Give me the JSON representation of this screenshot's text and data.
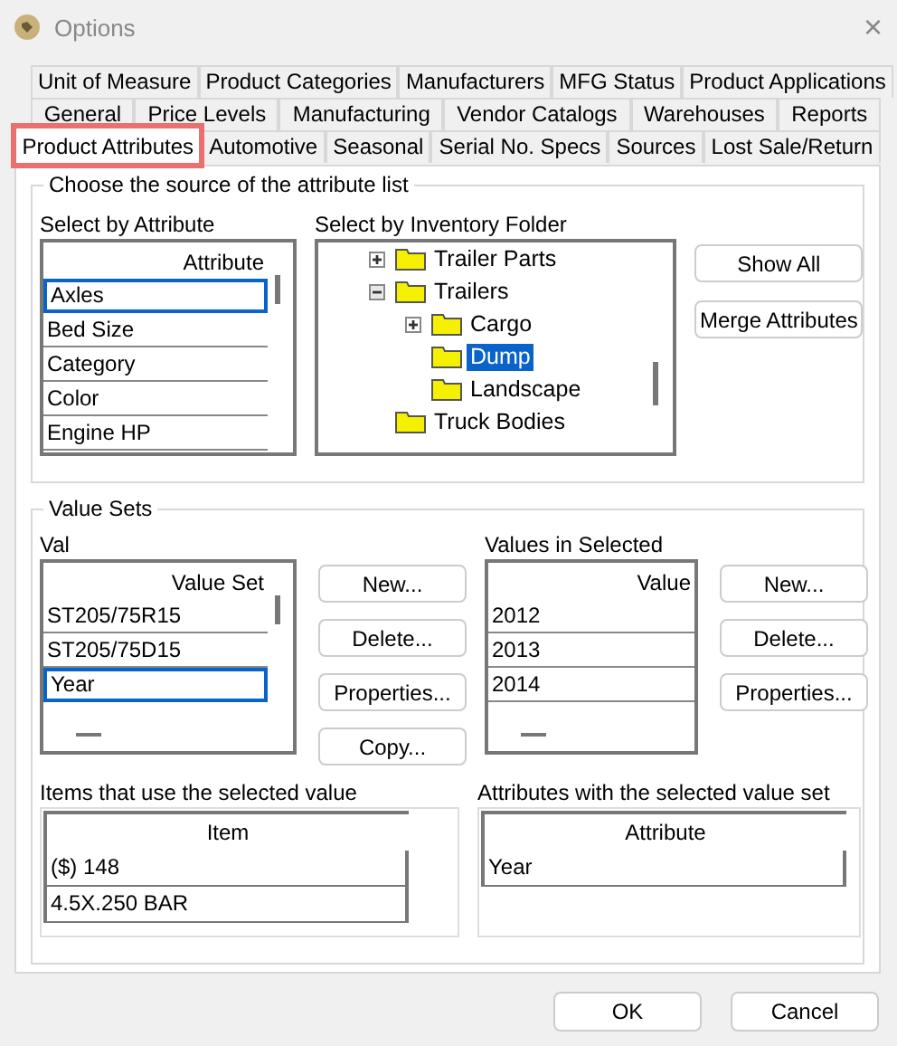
{
  "window": {
    "title": "Options",
    "close": "×"
  },
  "tab_rows": [
    [
      {
        "label": "Unit of Measure",
        "selected": false
      },
      {
        "label": "Product Categories",
        "selected": false
      },
      {
        "label": "Manufacturers",
        "selected": false
      },
      {
        "label": "MFG Status",
        "selected": false
      },
      {
        "label": "Product Applications",
        "selected": false
      }
    ],
    [
      {
        "label": "General",
        "selected": false
      },
      {
        "label": "Price Levels",
        "selected": false
      },
      {
        "label": "Manufacturing",
        "selected": false
      },
      {
        "label": "Vendor Catalogs",
        "selected": false
      },
      {
        "label": "Warehouses",
        "selected": false
      },
      {
        "label": "Reports",
        "selected": false
      }
    ],
    [
      {
        "label": "Product Attributes",
        "selected": true,
        "highlighted": true
      },
      {
        "label": "Automotive",
        "selected": false,
        "highlighted": false
      },
      {
        "label": "Seasonal",
        "selected": false,
        "highlighted": false
      },
      {
        "label": "Serial No. Specs",
        "selected": false,
        "highlighted": false
      },
      {
        "label": "Sources",
        "selected": false,
        "highlighted": false
      },
      {
        "label": "Lost Sale/Return",
        "selected": false,
        "highlighted": false
      }
    ]
  ],
  "source_group": {
    "title": "Choose the source of the attribute list",
    "attribute_list": {
      "label": "Select by Attribute",
      "column": "Attribute",
      "rows": [
        {
          "text": "Axles",
          "selected": true
        },
        {
          "text": "Bed Size",
          "selected": false
        },
        {
          "text": "Category",
          "selected": false
        },
        {
          "text": "Color",
          "selected": false
        },
        {
          "text": "Engine HP",
          "selected": false
        }
      ]
    },
    "folder_tree": {
      "label": "Select by Inventory Folder",
      "items": [
        {
          "name": "Trailer Parts",
          "expanded": false,
          "selected": false
        },
        {
          "name": "Trailers",
          "expanded": true,
          "selected": false,
          "children": [
            {
              "name": "Cargo",
              "expanded": false,
              "selected": false
            },
            {
              "name": "Dump",
              "selected": true
            },
            {
              "name": "Landscape",
              "selected": false
            }
          ]
        },
        {
          "name": "Truck Bodies",
          "selected": false
        }
      ]
    },
    "buttons": [
      "Show All",
      "Merge Attributes"
    ]
  },
  "value_group": {
    "title": "Value Sets",
    "value_sets": {
      "label": "Val",
      "column": "Value Set",
      "rows": [
        {
          "text": "ST205/75R15",
          "selected": false
        },
        {
          "text": "ST205/75D15",
          "selected": false
        },
        {
          "text": "Year",
          "selected": true
        }
      ]
    },
    "value_set_buttons": [
      "New...",
      "Delete...",
      "Properties...",
      "Copy..."
    ],
    "values": {
      "label": "Values in Selected",
      "column": "Value",
      "rows": [
        {
          "text": "2012",
          "selected": false
        },
        {
          "text": "2013",
          "selected": false
        },
        {
          "text": "2014",
          "selected": false
        }
      ]
    },
    "value_buttons": [
      "New...",
      "Delete...",
      "Properties..."
    ],
    "items_table": {
      "label": "Items that use the selected value",
      "column": "Item",
      "rows": [
        "($)  148",
        "4.5X.250 BAR"
      ]
    },
    "attributes_table": {
      "label": "Attributes with the selected value set",
      "column": "Attribute",
      "rows": [
        "Year"
      ]
    }
  },
  "footer_buttons": [
    "OK",
    "Cancel"
  ]
}
